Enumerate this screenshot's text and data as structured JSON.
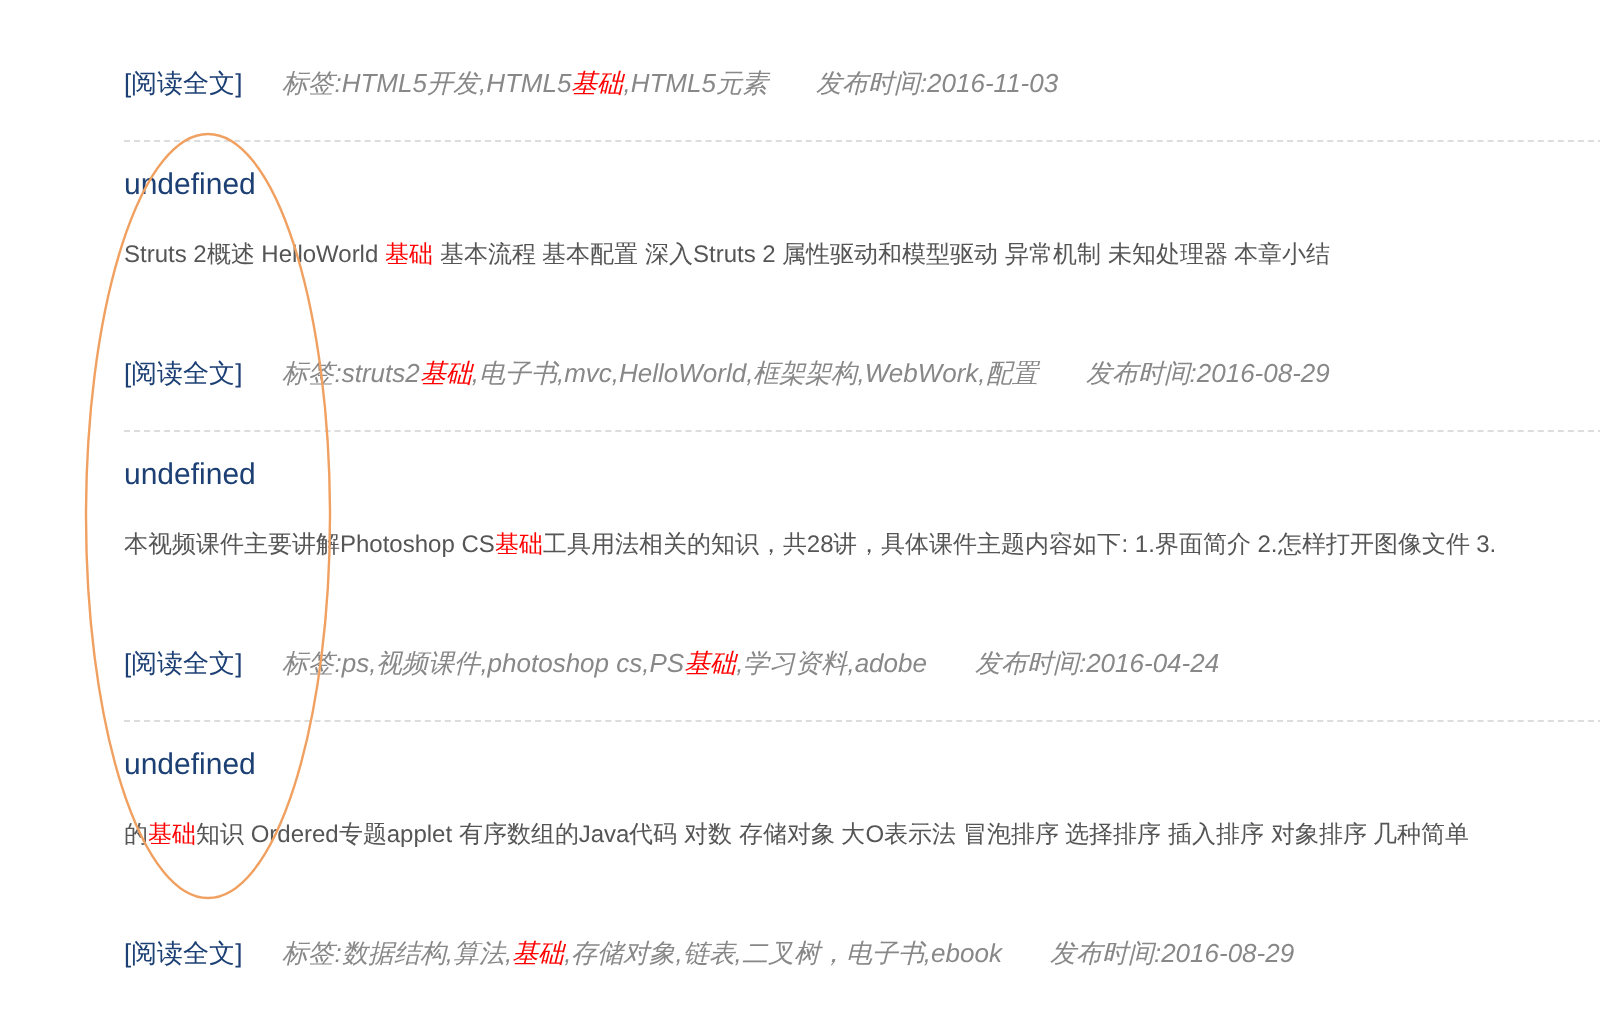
{
  "top_meta": {
    "read_more": "[阅读全文]",
    "tags": [
      {
        "text": "标签:HTML5开发,HTML5",
        "highlight": false
      },
      {
        "text": "基础",
        "highlight": true
      },
      {
        "text": ",HTML5元素",
        "highlight": false
      }
    ],
    "date": "发布时间:2016-11-03"
  },
  "articles": [
    {
      "title": "undefined",
      "summary": [
        {
          "text": "Struts 2概述 HelloWorld ",
          "highlight": false
        },
        {
          "text": "基础",
          "highlight": true
        },
        {
          "text": " 基本流程 基本配置 深入Struts 2 属性驱动和模型驱动 异常机制 未知处理器 本章小结",
          "highlight": false
        }
      ],
      "meta": {
        "read_more": "[阅读全文]",
        "tags": [
          {
            "text": "标签:struts2",
            "highlight": false
          },
          {
            "text": "基础",
            "highlight": true
          },
          {
            "text": ",电子书,mvc,HelloWorld,框架架构,WebWork,配置",
            "highlight": false
          }
        ],
        "date": "发布时间:2016-08-29"
      }
    },
    {
      "title": "undefined",
      "summary": [
        {
          "text": "本视频课件主要讲解Photoshop CS",
          "highlight": false
        },
        {
          "text": "基础",
          "highlight": true
        },
        {
          "text": "工具用法相关的知识，共28讲，具体课件主题内容如下: 1.界面简介 2.怎样打开图像文件 3.",
          "highlight": false
        }
      ],
      "meta": {
        "read_more": "[阅读全文]",
        "tags": [
          {
            "text": "标签:ps,视频课件,photoshop cs,PS",
            "highlight": false
          },
          {
            "text": "基础",
            "highlight": true
          },
          {
            "text": ",学习资料,adobe",
            "highlight": false
          }
        ],
        "date": "发布时间:2016-04-24"
      }
    },
    {
      "title": "undefined",
      "summary": [
        {
          "text": "的",
          "highlight": false
        },
        {
          "text": "基础",
          "highlight": true
        },
        {
          "text": "知识 Ordered专题applet 有序数组的Java代码 对数 存储对象 大O表示法 冒泡排序 选择排序 插入排序 对象排序 几种简单",
          "highlight": false
        }
      ],
      "meta": {
        "read_more": "[阅读全文]",
        "tags": [
          {
            "text": "标签:数据结构,算法,",
            "highlight": false
          },
          {
            "text": "基础",
            "highlight": true
          },
          {
            "text": ",存储对象,链表,二叉树，电子书,ebook",
            "highlight": false
          }
        ],
        "date": "发布时间:2016-08-29"
      }
    }
  ]
}
